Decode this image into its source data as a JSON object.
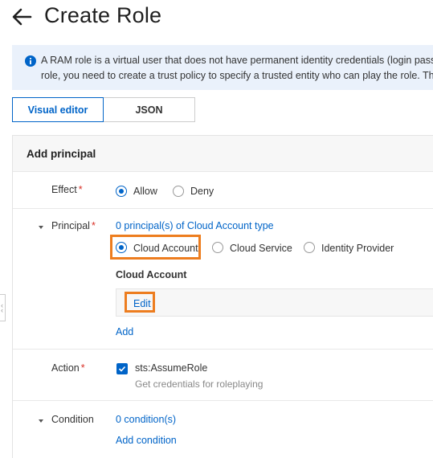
{
  "header": {
    "title": "Create Role",
    "back_icon": "arrow-left-icon"
  },
  "info": {
    "icon": "info-icon",
    "line1": "A RAM role is a virtual user that does not have permanent identity credentials (login password",
    "line2": "role, you need to create a trust policy to specify a trusted entity who can play the role. The tr"
  },
  "tabs": [
    {
      "label": "Visual editor",
      "active": true
    },
    {
      "label": "JSON",
      "active": false
    }
  ],
  "panel": {
    "title": "Add principal",
    "effect": {
      "label": "Effect",
      "options": [
        "Allow",
        "Deny"
      ],
      "selected": "Allow"
    },
    "principal": {
      "label": "Principal",
      "summary": "0 principal(s) of Cloud Account type",
      "options": [
        "Cloud Account",
        "Cloud Service",
        "Identity Provider"
      ],
      "selected": "Cloud Account",
      "section_label": "Cloud Account",
      "edit_label": "Edit",
      "add_label": "Add"
    },
    "action": {
      "label": "Action",
      "value": "sts:AssumeRole",
      "description": "Get credentials for roleplaying",
      "checked": true
    },
    "condition": {
      "label": "Condition",
      "summary": "0 condition(s)",
      "add_label": "Add condition"
    }
  },
  "colors": {
    "accent": "#0064c8",
    "highlight": "#ed7d1f",
    "required": "#d93026",
    "info_bg": "#eaf1fb"
  }
}
